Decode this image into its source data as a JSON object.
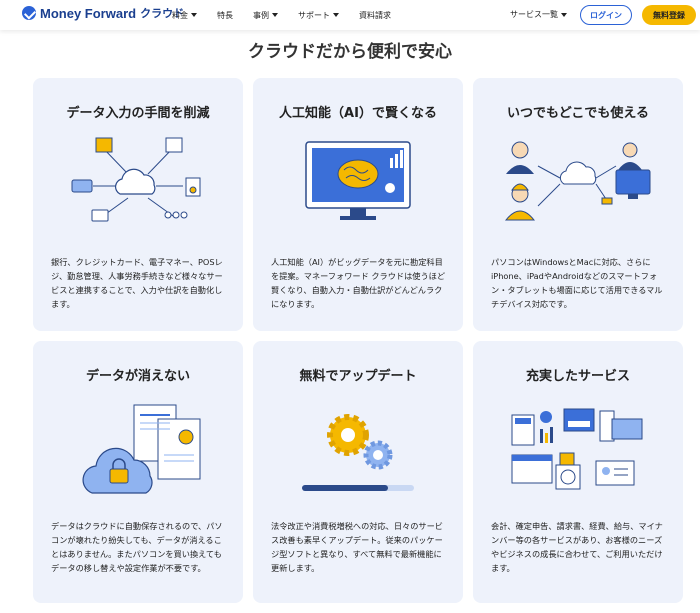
{
  "header": {
    "logo_text": "Money Forward",
    "logo_sub": "クラウド",
    "nav": [
      {
        "label": "料金",
        "dropdown": true
      },
      {
        "label": "特長",
        "dropdown": false
      },
      {
        "label": "事例",
        "dropdown": true
      },
      {
        "label": "サポート",
        "dropdown": true
      },
      {
        "label": "資料請求",
        "dropdown": false
      }
    ],
    "services_label": "サービス一覧",
    "login_label": "ログイン",
    "signup_label": "無料登録"
  },
  "section_title": "クラウドだから便利で安心",
  "colors": {
    "brand_blue": "#2b62d6",
    "accent_yellow": "#f5b800",
    "card_bg": "#eef2fb"
  },
  "cards": [
    {
      "title": "データ入力の手間を削減",
      "icon": "cloud-connections-illustration",
      "text": "銀行、クレジットカード、電子マネー、POSレジ、勤怠管理、人事労務手続きなど様々なサービスと連携することで、入力や仕訳を自動化します。"
    },
    {
      "title": "人工知能（AI）で賢くなる",
      "icon": "ai-brain-monitor-illustration",
      "text": "人工知能（AI）がビッグデータを元に勘定科目を提案。マネーフォワード クラウドは使うほど賢くなり、自動入力・自動仕訳がどんどんラクになります。"
    },
    {
      "title": "いつでもどこでも使える",
      "icon": "people-devices-illustration",
      "text": "パソコンはWindowsとMacに対応、さらにiPhone、iPadやAndroidなどのスマートフォン・タブレットも場面に応じて活用できるマルチデバイス対応です。"
    },
    {
      "title": "データが消えない",
      "icon": "cloud-lock-documents-illustration",
      "text": "データはクラウドに自動保存されるので、パソコンが壊れたり紛失しても、データが消えることはありません。またパソコンを買い換えてもデータの移し替えや設定作業が不要です。"
    },
    {
      "title": "無料でアップデート",
      "icon": "gears-progress-illustration",
      "text": "法令改正や消費税増税への対応、日々のサービス改善も素早くアップデート。従来のパッケージ型ソフトと異なり、すべて無料で最新機能に更新します。"
    },
    {
      "title": "充実したサービス",
      "icon": "business-documents-illustration",
      "text": "会計、確定申告、請求書、経費、給与、マイナンバー等の各サービスがあり、お客様のニーズやビジネスの成長に合わせて、ご利用いただけます。"
    }
  ]
}
